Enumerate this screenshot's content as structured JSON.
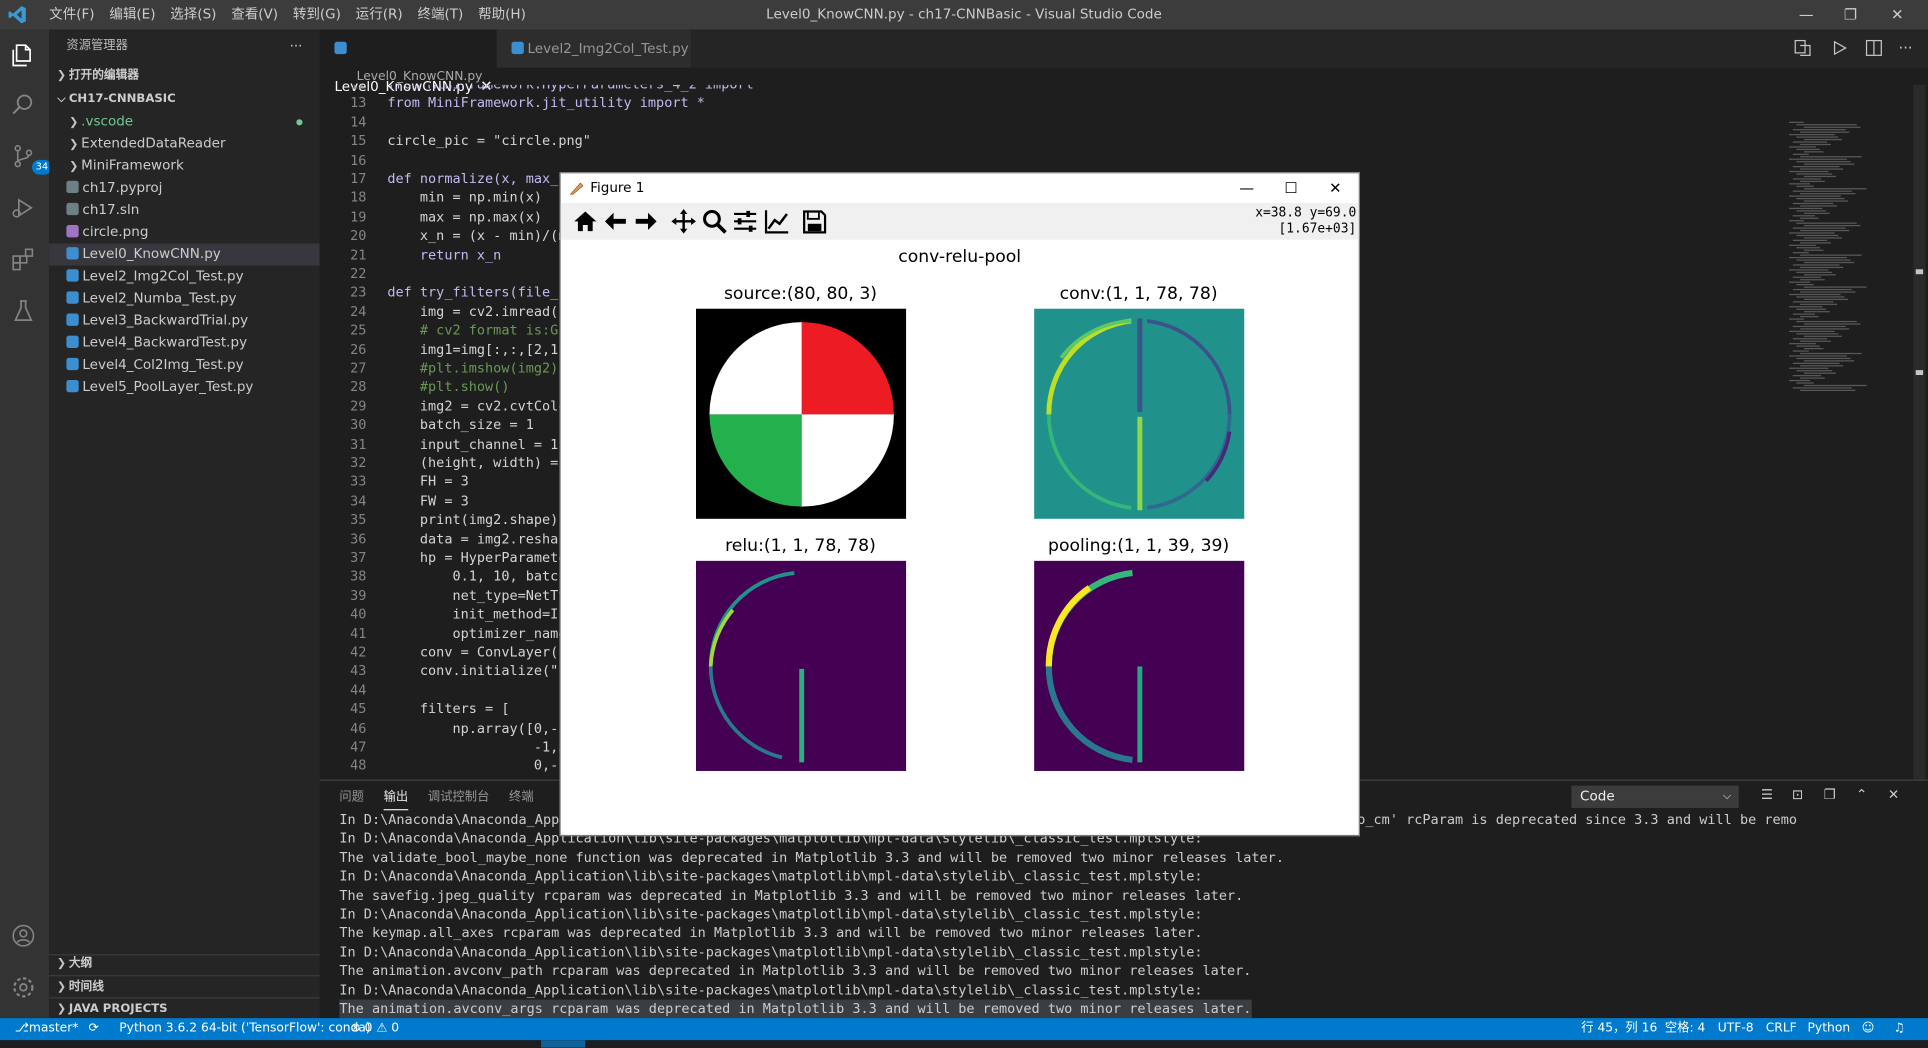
{
  "titlebar": {
    "menu": [
      "文件(F)",
      "编辑(E)",
      "选择(S)",
      "查看(V)",
      "转到(G)",
      "运行(R)",
      "终端(T)",
      "帮助(H)"
    ],
    "title": "Level0_KnowCNN.py - ch17-CNNBasic - Visual Studio Code",
    "minimize": "—",
    "restore": "❐",
    "close": "✕"
  },
  "activity": {
    "scm_badge": "34"
  },
  "sidebar": {
    "header": "资源管理器",
    "more": "···",
    "open_editors": "打开的编辑器",
    "project": "CH17-CNNBASIC",
    "items": [
      {
        "label": ".vscode",
        "kind": "folder",
        "color": "#73c991"
      },
      {
        "label": "ExtendedDataReader",
        "kind": "folder",
        "color": "#cccccc"
      },
      {
        "label": "MiniFramework",
        "kind": "folder",
        "color": "#cccccc"
      },
      {
        "label": "ch17.pyproj",
        "kind": "file",
        "color": "#cccccc"
      },
      {
        "label": "ch17.sln",
        "kind": "file",
        "color": "#cccccc"
      },
      {
        "label": "circle.png",
        "kind": "image",
        "color": "#cccccc"
      },
      {
        "label": "Level0_KnowCNN.py",
        "kind": "py",
        "color": "#cccccc"
      },
      {
        "label": "Level2_Img2Col_Test.py",
        "kind": "py",
        "color": "#cccccc"
      },
      {
        "label": "Level2_Numba_Test.py",
        "kind": "py",
        "color": "#cccccc"
      },
      {
        "label": "Level3_BackwardTrial.py",
        "kind": "py",
        "color": "#cccccc"
      },
      {
        "label": "Level4_BackwardTest.py",
        "kind": "py",
        "color": "#cccccc"
      },
      {
        "label": "Level4_Col2Img_Test.py",
        "kind": "py",
        "color": "#cccccc"
      },
      {
        "label": "Level5_PoolLayer_Test.py",
        "kind": "py",
        "color": "#cccccc"
      }
    ],
    "outline": "大纲",
    "timeline": "时间线",
    "java": "JAVA PROJECTS"
  },
  "tabs": {
    "active": "Level0_KnowCNN.py",
    "inactive": "Level2_Img2Col_Test.py",
    "close": "✕"
  },
  "breadcrumb": "Level0_KnowCNN.py",
  "code": [
    {
      "n": "12",
      "t": "from MiniFramework.HyperParameters_4_2 import *"
    },
    {
      "n": "13",
      "t": "from MiniFramework.jit_utility import *"
    },
    {
      "n": "14",
      "t": ""
    },
    {
      "n": "15",
      "t": "circle_pic = \"circle.png\""
    },
    {
      "n": "16",
      "t": ""
    },
    {
      "n": "17",
      "t": "def normalize(x, max_v"
    },
    {
      "n": "18",
      "t": "    min = np.min(x)"
    },
    {
      "n": "19",
      "t": "    max = np.max(x)"
    },
    {
      "n": "20",
      "t": "    x_n = (x - min)/(m"
    },
    {
      "n": "21",
      "t": "    return x_n"
    },
    {
      "n": "22",
      "t": ""
    },
    {
      "n": "23",
      "t": "def try_filters(file_n"
    },
    {
      "n": "24",
      "t": "    img = cv2.imread(f"
    },
    {
      "n": "25",
      "t": "    # cv2 format is:G "
    },
    {
      "n": "26",
      "t": "    img1=img[:,:,[2,1,"
    },
    {
      "n": "27",
      "t": "    #plt.imshow(img2)"
    },
    {
      "n": "28",
      "t": "    #plt.show()"
    },
    {
      "n": "29",
      "t": "    img2 = cv2.cvtColo"
    },
    {
      "n": "30",
      "t": "    batch_size = 1"
    },
    {
      "n": "31",
      "t": "    input_channel = 1"
    },
    {
      "n": "32",
      "t": "    (height, width) = "
    },
    {
      "n": "33",
      "t": "    FH = 3"
    },
    {
      "n": "34",
      "t": "    FW = 3"
    },
    {
      "n": "35",
      "t": "    print(img2.shape)"
    },
    {
      "n": "36",
      "t": "    data = img2.reshape"
    },
    {
      "n": "37",
      "t": "    hp = HyperParamete"
    },
    {
      "n": "38",
      "t": "        0.1, 10, batch"
    },
    {
      "n": "39",
      "t": "        net_type=NetTy"
    },
    {
      "n": "40",
      "t": "        init_method=In"
    },
    {
      "n": "41",
      "t": "        optimizer_name"
    },
    {
      "n": "42",
      "t": "    conv = ConvLayer(("
    },
    {
      "n": "43",
      "t": "    conv.initialize(\"k"
    },
    {
      "n": "44",
      "t": ""
    },
    {
      "n": "45",
      "t": "    filters = ["
    },
    {
      "n": "46",
      "t": "        np.array([0,-1"
    },
    {
      "n": "47",
      "t": "                  -1,5"
    },
    {
      "n": "48",
      "t": "                  0,-1"
    }
  ],
  "panel": {
    "tabs": [
      "问题",
      "输出",
      "调试控制台",
      "终端"
    ],
    "active_tab": "输出",
    "select": "Code",
    "lines": [
      "In D:\\Anaconda\\Anaconda_Appli                                                                             hathtext.fallback_to_cm' rcParam is deprecated since 3.3 and will be remo",
      "In D:\\Anaconda\\Anaconda_Application\\lib\\site-packages\\matplotlib\\mpl-data\\stylelib\\_classic_test.mplstyle:",
      "The validate_bool_maybe_none function was deprecated in Matplotlib 3.3 and will be removed two minor releases later.",
      "In D:\\Anaconda\\Anaconda_Application\\lib\\site-packages\\matplotlib\\mpl-data\\stylelib\\_classic_test.mplstyle:",
      "The savefig.jpeg_quality rcparam was deprecated in Matplotlib 3.3 and will be removed two minor releases later.",
      "In D:\\Anaconda\\Anaconda_Application\\lib\\site-packages\\matplotlib\\mpl-data\\stylelib\\_classic_test.mplstyle:",
      "The keymap.all_axes rcparam was deprecated in Matplotlib 3.3 and will be removed two minor releases later.",
      "In D:\\Anaconda\\Anaconda_Application\\lib\\site-packages\\matplotlib\\mpl-data\\stylelib\\_classic_test.mplstyle:",
      "The animation.avconv_path rcparam was deprecated in Matplotlib 3.3 and will be removed two minor releases later.",
      "In D:\\Anaconda\\Anaconda_Application\\lib\\site-packages\\matplotlib\\mpl-data\\stylelib\\_classic_test.mplstyle:",
      "The animation.avconv_args rcparam was deprecated in Matplotlib 3.3 and will be removed two minor releases later."
    ]
  },
  "statusbar": {
    "branch": "master*",
    "python": "Python 3.6.2 64-bit ('TensorFlow': conda)",
    "problems": "⊗ 0 ⚠ 0",
    "position": "行 45，列 16",
    "spaces": "空格: 4",
    "encoding": "UTF-8",
    "eol": "CRLF",
    "language": "Python"
  },
  "figure": {
    "title": "Figure 1",
    "coords": "x=38.8 y=69.0",
    "value": "[1.67e+03]",
    "suptitle": "conv-relu-pool",
    "panels": [
      {
        "title": "source:(80, 80, 3)"
      },
      {
        "title": "conv:(1, 1, 78, 78)"
      },
      {
        "title": "relu:(1, 1, 78, 78)"
      },
      {
        "title": "pooling:(1, 1, 39, 39)"
      }
    ],
    "colors": {
      "red": "#ed1c24",
      "green": "#22b14c",
      "viridis_teal": "#21918c",
      "viridis_dark": "#440154",
      "viridis_yellow": "#fde725"
    }
  },
  "colors": {
    "accent": "#007acc",
    "titlebar": "#3c3c3c",
    "sidebar": "#252526",
    "editor": "#1e1e1e"
  }
}
